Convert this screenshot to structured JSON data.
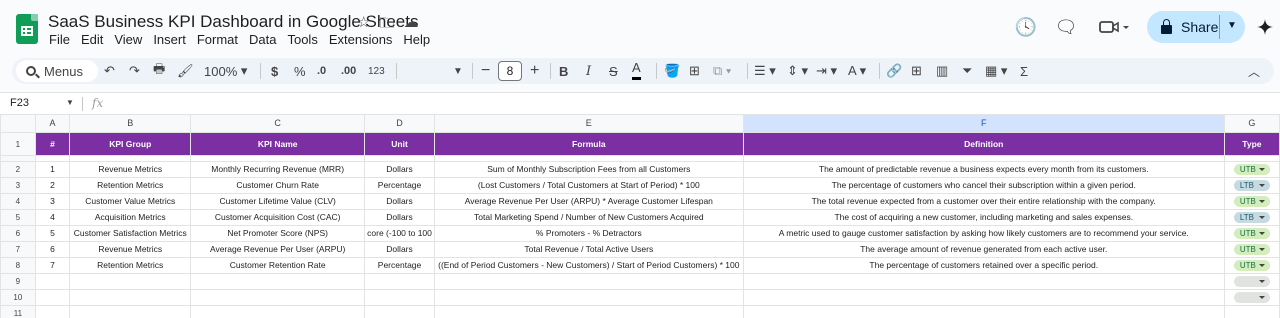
{
  "app": {
    "doc_title": "SaaS Business KPI Dashboard in Google Sheets",
    "menus": [
      "File",
      "Edit",
      "View",
      "Insert",
      "Format",
      "Data",
      "Tools",
      "Extensions",
      "Help"
    ],
    "share_label": "Share"
  },
  "toolbar": {
    "search_label": "Menus",
    "zoom": "100%",
    "currency": "$",
    "percent": "%",
    "dec_decrease": ".0",
    "dec_increase": ".00",
    "number_format": "123",
    "font_size": "8",
    "bold": "B",
    "italic": "I",
    "text_color": "A",
    "functions": "Σ"
  },
  "formula_bar": {
    "cell_ref": "F23",
    "fx": "fx"
  },
  "sheet": {
    "column_letters": [
      "A",
      "B",
      "C",
      "D",
      "E",
      "F",
      "G"
    ],
    "selected_column": "F",
    "header": [
      "#",
      "KPI Group",
      "KPI Name",
      "Unit",
      "Formula",
      "Definition",
      "Type"
    ],
    "rows": [
      {
        "num": "1",
        "group": "Revenue Metrics",
        "name": "Monthly Recurring Revenue (MRR)",
        "unit": "Dollars",
        "formula": "Sum of Monthly Subscription Fees from all Customers",
        "definition": "The amount of predictable revenue a business expects every month from its customers.",
        "type": "UTB"
      },
      {
        "num": "2",
        "group": "Retention Metrics",
        "name": "Customer Churn Rate",
        "unit": "Percentage",
        "formula": "(Lost Customers / Total Customers at Start of Period) * 100",
        "definition": "The percentage of customers who cancel their subscription within a given period.",
        "type": "LTB"
      },
      {
        "num": "3",
        "group": "Customer Value Metrics",
        "name": "Customer Lifetime Value (CLV)",
        "unit": "Dollars",
        "formula": "Average Revenue Per User (ARPU) * Average Customer Lifespan",
        "definition": "The total revenue expected from a customer over their entire relationship with the company.",
        "type": "UTB"
      },
      {
        "num": "4",
        "group": "Acquisition Metrics",
        "name": "Customer Acquisition Cost (CAC)",
        "unit": "Dollars",
        "formula": "Total Marketing Spend / Number of New Customers Acquired",
        "definition": "The cost of acquiring a new customer, including marketing and sales expenses.",
        "type": "LTB"
      },
      {
        "num": "5",
        "group": "Customer Satisfaction Metrics",
        "name": "Net Promoter Score (NPS)",
        "unit": "core (-100 to 100",
        "formula": "% Promoters - % Detractors",
        "definition": "A metric used to gauge customer satisfaction by asking how likely customers are to recommend your service.",
        "type": "UTB"
      },
      {
        "num": "6",
        "group": "Revenue Metrics",
        "name": "Average Revenue Per User (ARPU)",
        "unit": "Dollars",
        "formula": "Total Revenue / Total Active Users",
        "definition": "The average amount of revenue generated from each active user.",
        "type": "UTB"
      },
      {
        "num": "7",
        "group": "Retention Metrics",
        "name": "Customer Retention Rate",
        "unit": "Percentage",
        "formula": "((End of Period Customers - New Customers) / Start of Period Customers) * 100",
        "definition": "The percentage of customers retained over a specific period.",
        "type": "UTB"
      }
    ],
    "row_numbers": [
      "1",
      "2",
      "3",
      "4",
      "5",
      "6",
      "7",
      "8",
      "9",
      "10",
      "11"
    ]
  },
  "colors": {
    "header_bg": "#7b2fa3",
    "utb_chip": "#d4edbc",
    "ltb_chip": "#c6dbe1",
    "share_bg": "#c2e7ff"
  }
}
